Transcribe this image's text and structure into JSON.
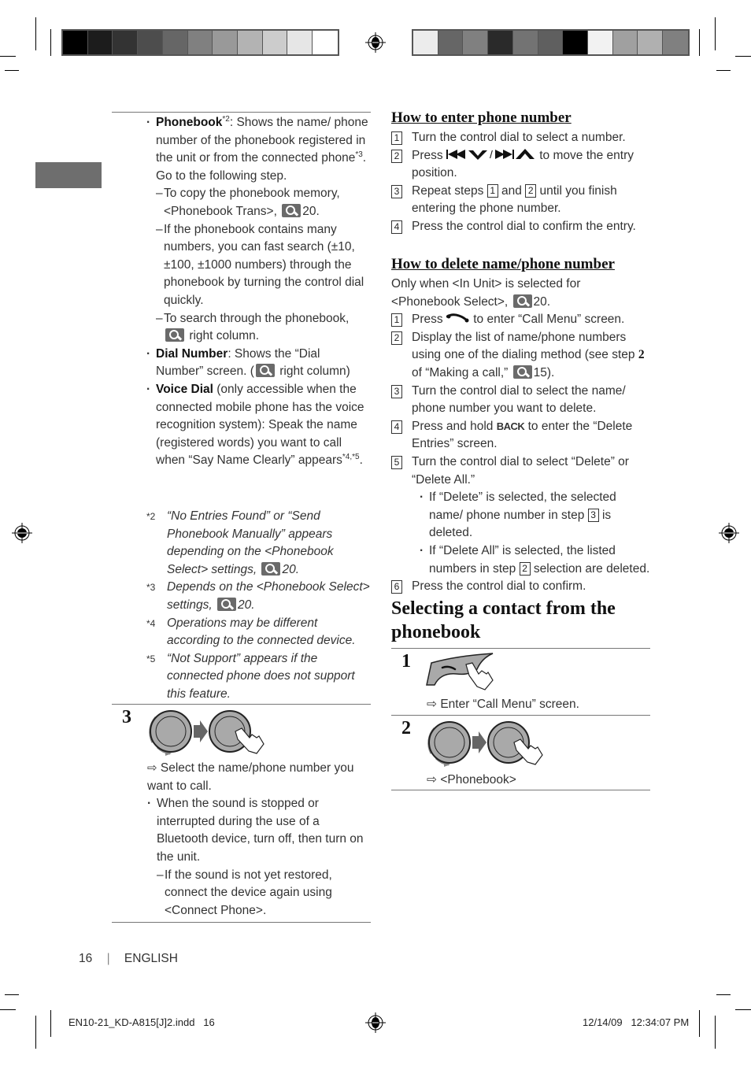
{
  "left_column": {
    "items": [
      {
        "term": "Phonebook",
        "sup": "*2",
        "text_a": ": Shows the name/ phone number of the phonebook registered in the unit or from the connected phone",
        "sup2": "*3",
        "text_b": ". Go to the following step.",
        "subitems": [
          {
            "text": "To copy the phonebook memory, <Phonebook Trans>,",
            "ref": "20."
          },
          {
            "text": "If the phonebook contains many numbers, you can fast search (±10, ±100, ±1000 numbers) through the phonebook by turning the control dial quickly."
          },
          {
            "text": "To search through the phonebook,",
            "ref": "right column."
          }
        ]
      },
      {
        "term": "Dial Number",
        "text_a": ": Shows the “Dial Number” screen. (",
        "ref": "right column)"
      },
      {
        "term": "Voice Dial",
        "text_a": " (only accessible when the connected mobile phone has the voice recognition system): Speak the name (registered words) you want to call when “Say Name Clearly” appears",
        "sup": "*4,*5",
        "text_b": "."
      }
    ],
    "footnotes": [
      {
        "mark": "*2",
        "text": "“No Entries Found” or “Send Phonebook Manually” appears depending on the <Phonebook Select> settings,",
        "ref": "20."
      },
      {
        "mark": "*3",
        "text": "Depends on the <Phonebook Select> settings,",
        "ref": "20."
      },
      {
        "mark": "*4",
        "text": "Operations may be different according to the connected device."
      },
      {
        "mark": "*5",
        "text": "“Not Support” appears if the connected phone does not support this feature."
      }
    ],
    "step3": {
      "number": "3",
      "arrow": "⇨",
      "result": "Select the name/phone number you want to call.",
      "note": "When the sound is stopped or interrupted during the use of a Bluetooth device, turn off, then turn on the unit.",
      "subnote": "If the sound is not yet restored, connect the device again using <Connect Phone>."
    }
  },
  "right_column": {
    "enter_section": {
      "title": "How to enter phone number",
      "steps": [
        {
          "n": "1",
          "text": "Turn the control dial to select a number."
        },
        {
          "n": "2",
          "pre": "Press",
          "post": "to move the entry position."
        },
        {
          "n": "3",
          "pre": "Repeat steps",
          "a": "1",
          "mid": "and",
          "b": "2",
          "post": "until you finish entering the phone number."
        },
        {
          "n": "4",
          "text": "Press the control dial to confirm the entry."
        }
      ]
    },
    "delete_section": {
      "title": "How to delete name/phone number",
      "intro": "Only when <In Unit> is selected for <Phonebook Select>,",
      "intro_ref": "20.",
      "steps": [
        {
          "n": "1",
          "pre": "Press",
          "post": "to enter “Call Menu” screen."
        },
        {
          "n": "2",
          "pre": "Display the list of name/phone numbers using one of the dialing method (see step",
          "bold": "2",
          "mid": "of “Making a call,”",
          "ref": "15)."
        },
        {
          "n": "3",
          "text": "Turn the control dial to select the name/ phone number you want to delete."
        },
        {
          "n": "4",
          "pre": "Press and hold",
          "bold": "BACK",
          "post": "to enter the “Delete Entries” screen."
        },
        {
          "n": "5",
          "text": "Turn the control dial to select “Delete” or “Delete All.”"
        },
        {
          "n": "6",
          "text": "Press the control dial to confirm."
        }
      ],
      "step5_bullets": [
        {
          "pre": "If “Delete” is selected, the selected name/ phone number in step",
          "box": "3",
          "post": "is deleted."
        },
        {
          "pre": "If “Delete All” is selected, the listed numbers in step",
          "box": "2",
          "post": "selection are deleted."
        }
      ]
    },
    "select_section": {
      "title": "Selecting a contact from the phonebook",
      "steps": [
        {
          "n": "1",
          "arrow": "⇨",
          "result": "Enter “Call Menu” screen."
        },
        {
          "n": "2",
          "arrow": "⇨",
          "result": "<Phonebook>"
        }
      ]
    }
  },
  "footer": {
    "page_number": "16",
    "separator": "|",
    "language": "ENGLISH",
    "file": "EN10-21_KD-A815[J]2.indd   16",
    "timestamp": "12/14/09   12:34:07 PM"
  },
  "colors": {
    "left_bar": [
      "#000000",
      "#1c1c1c",
      "#333333",
      "#4d4d4d",
      "#666666",
      "#808080",
      "#999999",
      "#b3b3b3",
      "#cccccc",
      "#e6e6e6",
      "#ffffff"
    ],
    "right_bar": [
      "#ececec",
      "#666666",
      "#808080",
      "#2a2a2a",
      "#737373",
      "#5f5f5f",
      "#000000",
      "#f2f2f2",
      "#a0a0a0",
      "#b0b0b0",
      "#808080"
    ],
    "tab_block": "#6e6e6e"
  }
}
